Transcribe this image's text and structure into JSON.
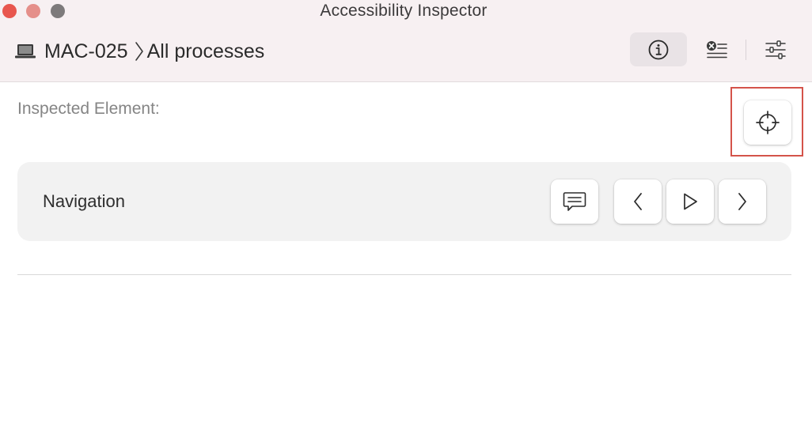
{
  "window": {
    "title": "Accessibility Inspector",
    "traffic_lights": [
      "close",
      "minimize",
      "zoom"
    ]
  },
  "toolbar": {
    "breadcrumb": {
      "icon": "laptop-icon",
      "target": "MAC-025",
      "separator_icon": "chevron-right-icon",
      "scope": "All processes"
    },
    "buttons": [
      {
        "name": "inspector-info",
        "icon": "info-circle-icon",
        "selected": true
      },
      {
        "name": "audit",
        "icon": "audit-list-icon",
        "selected": false
      },
      {
        "name": "settings",
        "icon": "sliders-icon",
        "selected": false
      }
    ]
  },
  "inspected": {
    "label": "Inspected Element:",
    "target_button_icon": "crosshair-icon",
    "highlight_color": "#d4534a"
  },
  "navigation": {
    "label": "Navigation",
    "buttons": [
      {
        "name": "speak",
        "icon": "speech-bubble-icon"
      },
      {
        "name": "previous",
        "icon": "chevron-left-icon"
      },
      {
        "name": "play",
        "icon": "play-icon"
      },
      {
        "name": "next",
        "icon": "chevron-right-icon"
      }
    ]
  },
  "colors": {
    "titlebar_bg": "#f7f0f2",
    "close": "#e8564e",
    "minimize": "#e58f8a",
    "zoom": "#7d7a7b"
  }
}
